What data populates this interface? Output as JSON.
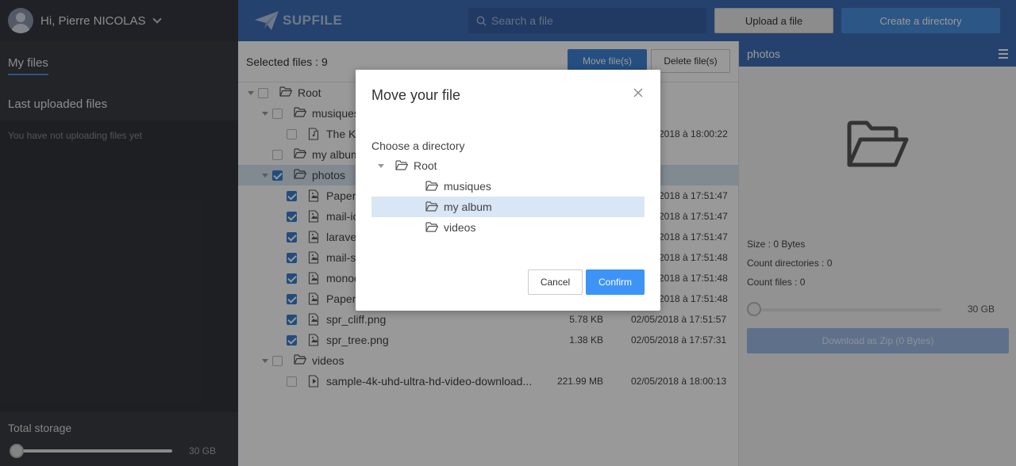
{
  "user": {
    "greeting": "Hi, Pierre NICOLAS"
  },
  "sidebar": {
    "my_files": "My files",
    "last_uploaded": "Last uploaded files",
    "empty_text": "You have not uploading files yet",
    "storage_label": "Total storage",
    "storage_max": "30 GB"
  },
  "header": {
    "logo": "SUPFILE",
    "search_placeholder": "Search a file",
    "upload_label": "Upload a file",
    "create_label": "Create a directory"
  },
  "toolbar": {
    "selected": "Selected files : 9",
    "move_label": "Move file(s)",
    "delete_label": "Delete file(s)"
  },
  "tree": {
    "rows": [
      {
        "name": "Root",
        "level": 0,
        "type": "folder",
        "caret": true,
        "checked": false,
        "size": "",
        "date": ""
      },
      {
        "name": "musiques",
        "level": 1,
        "type": "folder",
        "caret": true,
        "checked": false,
        "size": "",
        "date": ""
      },
      {
        "name": "The K",
        "level": 2,
        "type": "audio",
        "caret": false,
        "checked": false,
        "size": "",
        "date": "2018 à 18:00:22"
      },
      {
        "name": "my album",
        "level": 1,
        "type": "folder",
        "caret": false,
        "checked": false,
        "size": "",
        "date": ""
      },
      {
        "name": "photos",
        "level": 1,
        "type": "folder",
        "caret": true,
        "checked": true,
        "selected": true,
        "size": "",
        "date": ""
      },
      {
        "name": "Paper",
        "level": 2,
        "type": "image",
        "caret": false,
        "checked": true,
        "size": "",
        "date": "2018 à 17:51:47"
      },
      {
        "name": "mail-ic",
        "level": 2,
        "type": "image",
        "caret": false,
        "checked": true,
        "size": "",
        "date": "2018 à 17:51:47"
      },
      {
        "name": "larave",
        "level": 2,
        "type": "image",
        "caret": false,
        "checked": true,
        "size": "",
        "date": "2018 à 17:51:47"
      },
      {
        "name": "mail-s",
        "level": 2,
        "type": "image",
        "caret": false,
        "checked": true,
        "size": "",
        "date": "2018 à 17:51:48"
      },
      {
        "name": "monoc",
        "level": 2,
        "type": "image",
        "caret": false,
        "checked": true,
        "size": "",
        "date": "2018 à 17:51:48"
      },
      {
        "name": "Paper",
        "level": 2,
        "type": "image",
        "caret": false,
        "checked": true,
        "size": "",
        "date": "2018 à 17:51:48"
      },
      {
        "name": "spr_cliff.png",
        "level": 2,
        "type": "image",
        "caret": false,
        "checked": true,
        "size": "5.78 KB",
        "date": "02/05/2018 à 17:51:57"
      },
      {
        "name": "spr_tree.png",
        "level": 2,
        "type": "image",
        "caret": false,
        "checked": true,
        "size": "1.38 KB",
        "date": "02/05/2018 à 17:57:31"
      },
      {
        "name": "videos",
        "level": 1,
        "type": "folder",
        "caret": true,
        "checked": false,
        "size": "",
        "date": ""
      },
      {
        "name": "sample-4k-uhd-ultra-hd-video-download...",
        "level": 2,
        "type": "video",
        "caret": false,
        "checked": false,
        "size": "221.99 MB",
        "date": "02/05/2018 à 18:00:13"
      }
    ]
  },
  "details": {
    "title": "photos",
    "size": "Size : 0 Bytes",
    "count_dirs": "Count directories : 0",
    "count_files": "Count files : 0",
    "max": "30 GB",
    "zip_label": "Download as Zip (0 Bytes)"
  },
  "modal": {
    "title": "Move your file",
    "label": "Choose a directory",
    "items": [
      {
        "name": "Root",
        "level": 0,
        "caret": true,
        "highlight": false
      },
      {
        "name": "musiques",
        "level": 1,
        "caret": false,
        "highlight": false
      },
      {
        "name": "my album",
        "level": 1,
        "caret": false,
        "highlight": true
      },
      {
        "name": "videos",
        "level": 1,
        "caret": false,
        "highlight": false
      }
    ],
    "cancel_label": "Cancel",
    "confirm_label": "Confirm"
  },
  "colors": {
    "accent": "#3e6eb8",
    "primary_button": "#3d94f6",
    "sidebar_bg": "#3a3d42"
  }
}
